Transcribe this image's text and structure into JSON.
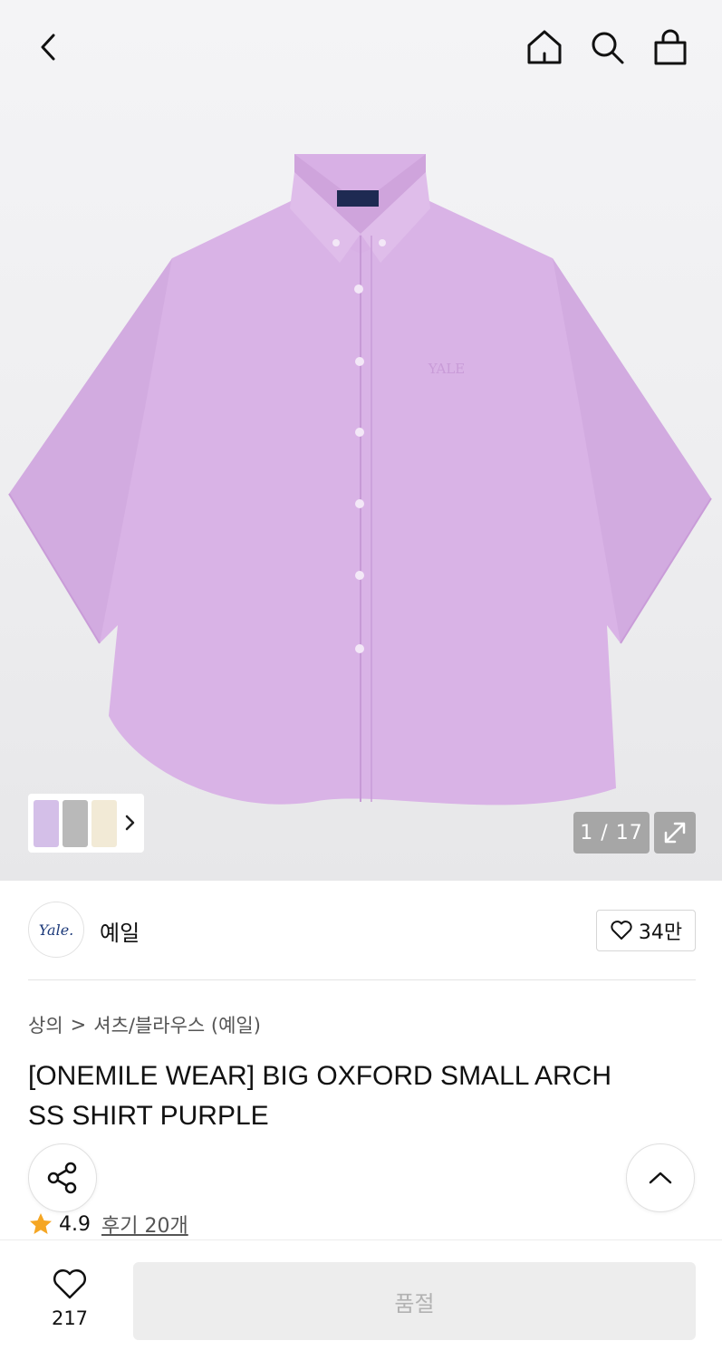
{
  "header": {
    "back_icon": "chevron-left-icon",
    "home_icon": "home-icon",
    "search_icon": "search-icon",
    "cart_icon": "shopping-bag-icon"
  },
  "gallery": {
    "counter": "1 / 17",
    "expand_icon": "expand-icon",
    "thumb_next_icon": "chevron-right-icon",
    "shirt_color": "#d9b3e6"
  },
  "brand": {
    "logo_text": "Yale.",
    "name": "예일",
    "like_count": "34만"
  },
  "breadcrumb": {
    "level1": "상의",
    "separator": ">",
    "level2": "셔츠/블라우스 (예일)"
  },
  "product": {
    "title_line1": "[ONEMILE WEAR] BIG OXFORD SMALL ARCH",
    "title_line2": "SS SHIRT PURPLE",
    "rating": "4.9",
    "reviews": "후기 20개",
    "chest_logo": "YALE"
  },
  "bottom_bar": {
    "wish_count": "217",
    "soldout_label": "품절"
  },
  "colors": {
    "accent_star": "#f5a623",
    "soldout_bg": "#ededed",
    "soldout_text": "#b2b2b2"
  }
}
